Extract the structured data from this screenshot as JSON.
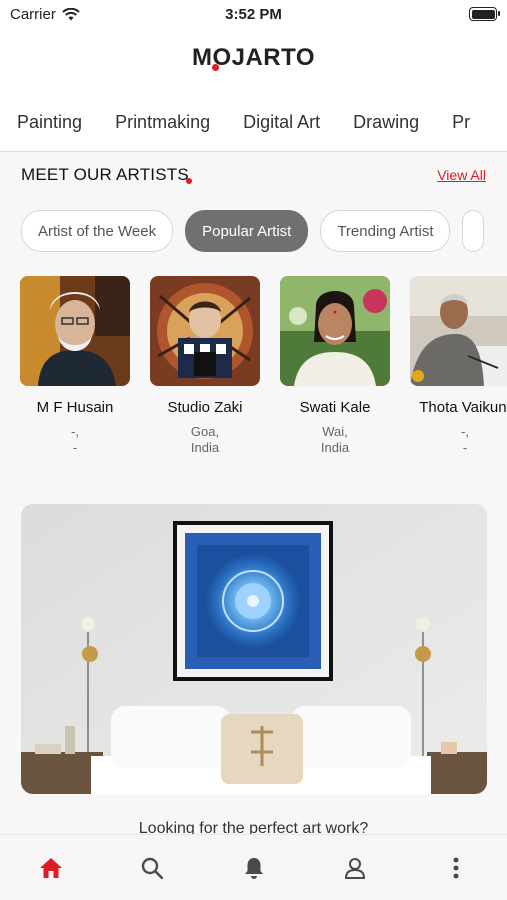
{
  "status": {
    "carrier": "Carrier",
    "time": "3:52 PM"
  },
  "brand": {
    "logo": "MOJARTO",
    "accent": "#e11b23"
  },
  "categories": [
    "Painting",
    "Printmaking",
    "Digital Art",
    "Drawing",
    "Pr"
  ],
  "artists_section": {
    "title": "MEET OUR ARTISTS",
    "view_all": "View All",
    "filters": [
      "Artist of the Week",
      "Popular Artist",
      "Trending Artist"
    ],
    "active_filter": "Popular Artist",
    "artists": [
      {
        "name": "M F Husain",
        "city": "-,",
        "country": "-"
      },
      {
        "name": "Studio Zaki",
        "city": "Goa,",
        "country": "India"
      },
      {
        "name": "Swati Kale",
        "city": "Wai,",
        "country": "India"
      },
      {
        "name": "Thota Vaikunt",
        "city": "-,",
        "country": "-"
      }
    ]
  },
  "promo": {
    "text": "Looking for the perfect art work?"
  },
  "nav": {
    "items": [
      "home-icon",
      "search-icon",
      "bell-icon",
      "profile-icon",
      "more-icon"
    ],
    "active": "home-icon"
  }
}
